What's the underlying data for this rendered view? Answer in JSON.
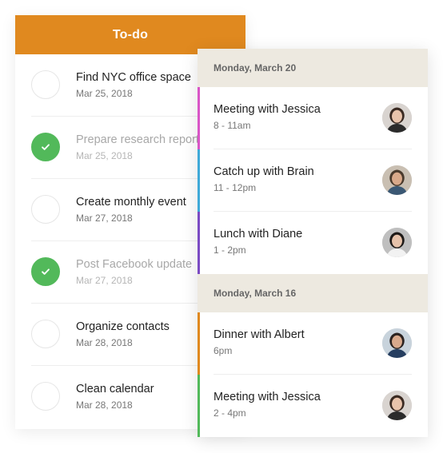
{
  "todo": {
    "header": "To-do",
    "accent": "#e0891f",
    "done_color": "#52b95a",
    "items": [
      {
        "title": "Find NYC office space",
        "date": "Mar 25, 2018",
        "done": false
      },
      {
        "title": "Prepare research report",
        "date": "Mar 25, 2018",
        "done": true
      },
      {
        "title": "Create monthly event",
        "date": "Mar 27, 2018",
        "done": false
      },
      {
        "title": "Post Facebook update",
        "date": "Mar 27, 2018",
        "done": true
      },
      {
        "title": "Organize contacts",
        "date": "Mar 28, 2018",
        "done": false
      },
      {
        "title": "Clean calendar",
        "date": "Mar 28, 2018",
        "done": false
      }
    ]
  },
  "calendar": {
    "day_header_bg": "#ede9e0",
    "days": [
      {
        "label": "Monday, March 20",
        "events": [
          {
            "title": "Meeting with Jessica",
            "time": "8 - 11am",
            "color": "#d955c7",
            "avatar": "avatar-jessica-icon"
          },
          {
            "title": "Catch up with Brain",
            "time": "11 - 12pm",
            "color": "#3fa9d8",
            "avatar": "avatar-brain-icon"
          },
          {
            "title": "Lunch with Diane",
            "time": "1 - 2pm",
            "color": "#7b4bc4",
            "avatar": "avatar-diane-icon"
          }
        ]
      },
      {
        "label": "Monday, March 16",
        "events": [
          {
            "title": "Dinner with Albert",
            "time": "6pm",
            "color": "#e0891f",
            "avatar": "avatar-albert-icon"
          },
          {
            "title": "Meeting with Jessica",
            "time": "2 - 4pm",
            "color": "#52b95a",
            "avatar": "avatar-jessica-icon"
          }
        ]
      }
    ]
  }
}
